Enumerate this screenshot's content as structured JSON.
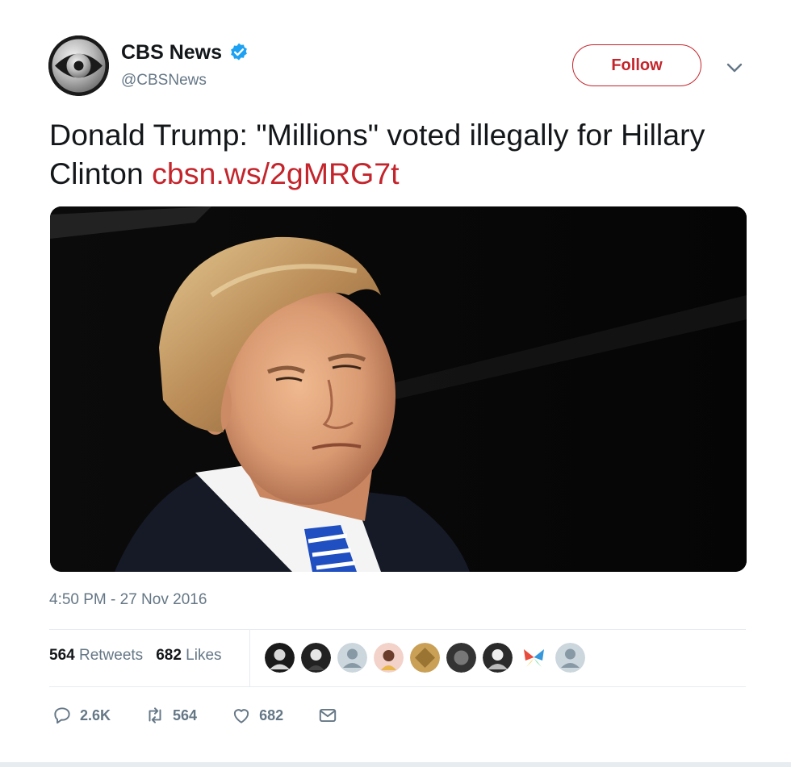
{
  "author": {
    "display_name": "CBS News",
    "handle": "@CBSNews",
    "verified_icon": "verified-badge-icon"
  },
  "follow_label": "Follow",
  "tweet": {
    "text": "Donald Trump: \"Millions\" voted illegally for Hillary Clinton",
    "link": "cbsn.ws/2gMRG7t"
  },
  "timestamp": "4:50 PM - 27 Nov 2016",
  "stats": {
    "retweets_count": "564",
    "retweets_label": "Retweets",
    "likes_count": "682",
    "likes_label": "Likes"
  },
  "actions": {
    "reply_count": "2.6K",
    "retweet_count": "564",
    "like_count": "682"
  },
  "colors": {
    "accent": "#c4242b",
    "secondary_text": "#657786",
    "primary_text": "#14171a",
    "verified": "#1da1f2",
    "divider": "#e6ecf0"
  }
}
